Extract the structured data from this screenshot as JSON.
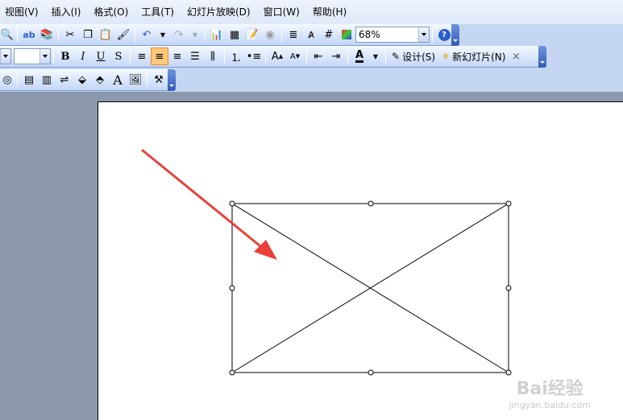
{
  "menu": [
    {
      "label": "视图(V)"
    },
    {
      "label": "插入(I)"
    },
    {
      "label": "格式(O)"
    },
    {
      "label": "工具(T)"
    },
    {
      "label": "幻灯片放映(D)"
    },
    {
      "label": "窗口(W)"
    },
    {
      "label": "帮助(H)"
    }
  ],
  "standard_toolbar": {
    "zoom_value": "68%",
    "help_icon": "help-icon"
  },
  "formatting_toolbar": {
    "font_size_value": "",
    "design_label": "设计(S)",
    "new_slide_label": "新幻灯片(N)"
  },
  "watermark": {
    "brand": "Bai经验",
    "url": "jingyan.baidu.com"
  },
  "colors": {
    "arrow": "#e8413c",
    "toolbar_end": "#2e5cb8",
    "active_button": "#ffc97a"
  }
}
